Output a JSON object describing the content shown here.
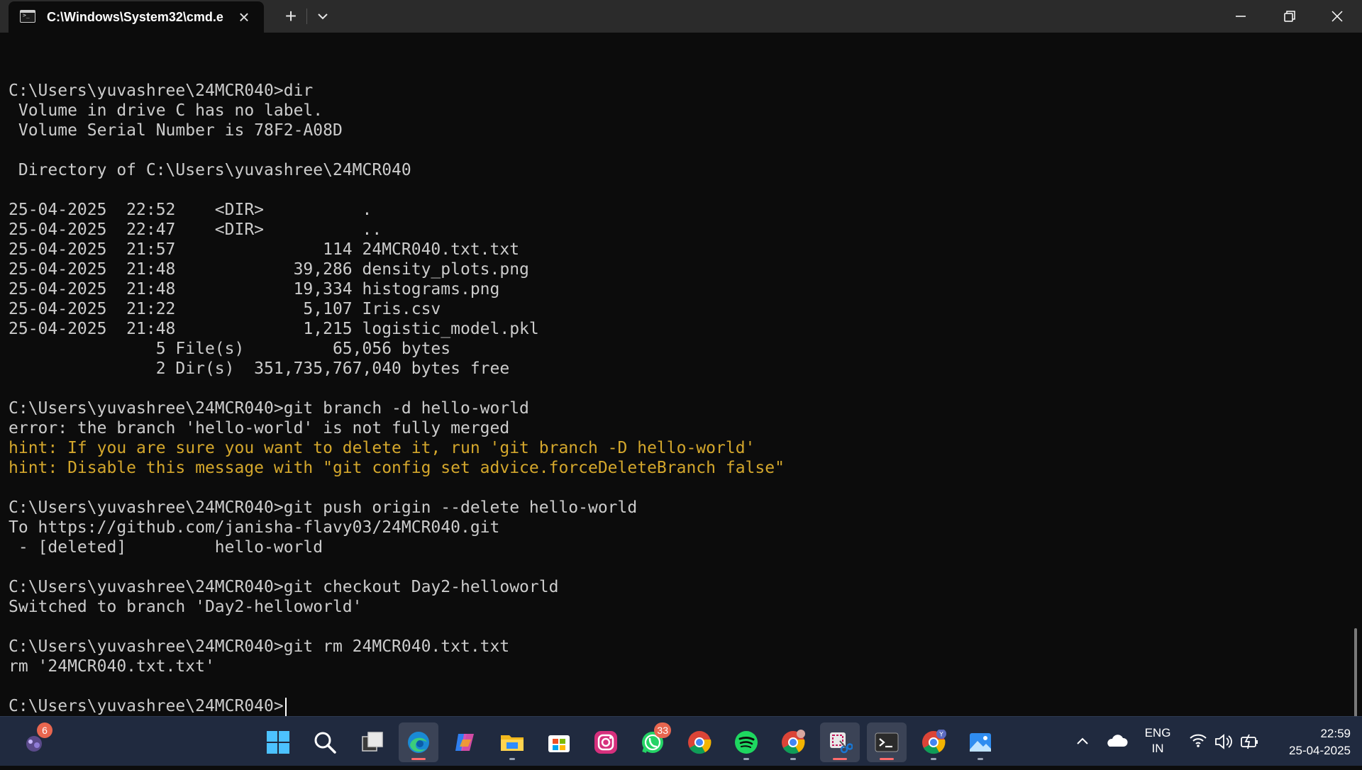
{
  "window": {
    "tab_title": "C:\\Windows\\System32\\cmd.e"
  },
  "terminal": {
    "lines": [
      {
        "text": "",
        "type": "normal"
      },
      {
        "text": "C:\\Users\\yuvashree\\24MCR040>dir",
        "type": "normal"
      },
      {
        "text": " Volume in drive C has no label.",
        "type": "normal"
      },
      {
        "text": " Volume Serial Number is 78F2-A08D",
        "type": "normal"
      },
      {
        "text": "",
        "type": "normal"
      },
      {
        "text": " Directory of C:\\Users\\yuvashree\\24MCR040",
        "type": "normal"
      },
      {
        "text": "",
        "type": "normal"
      },
      {
        "text": "25-04-2025  22:52    <DIR>          .",
        "type": "normal"
      },
      {
        "text": "25-04-2025  22:47    <DIR>          ..",
        "type": "normal"
      },
      {
        "text": "25-04-2025  21:57               114 24MCR040.txt.txt",
        "type": "normal"
      },
      {
        "text": "25-04-2025  21:48            39,286 density_plots.png",
        "type": "normal"
      },
      {
        "text": "25-04-2025  21:48            19,334 histograms.png",
        "type": "normal"
      },
      {
        "text": "25-04-2025  21:22             5,107 Iris.csv",
        "type": "normal"
      },
      {
        "text": "25-04-2025  21:48             1,215 logistic_model.pkl",
        "type": "normal"
      },
      {
        "text": "               5 File(s)         65,056 bytes",
        "type": "normal"
      },
      {
        "text": "               2 Dir(s)  351,735,767,040 bytes free",
        "type": "normal"
      },
      {
        "text": "",
        "type": "normal"
      },
      {
        "text": "C:\\Users\\yuvashree\\24MCR040>git branch -d hello-world",
        "type": "normal"
      },
      {
        "text": "error: the branch 'hello-world' is not fully merged",
        "type": "normal"
      },
      {
        "text": "hint: If you are sure you want to delete it, run 'git branch -D hello-world'",
        "type": "hint"
      },
      {
        "text": "hint: Disable this message with \"git config set advice.forceDeleteBranch false\"",
        "type": "hint"
      },
      {
        "text": "",
        "type": "normal"
      },
      {
        "text": "C:\\Users\\yuvashree\\24MCR040>git push origin --delete hello-world",
        "type": "normal"
      },
      {
        "text": "To https://github.com/janisha-flavy03/24MCR040.git",
        "type": "normal"
      },
      {
        "text": " - [deleted]         hello-world",
        "type": "normal"
      },
      {
        "text": "",
        "type": "normal"
      },
      {
        "text": "C:\\Users\\yuvashree\\24MCR040>git checkout Day2-helloworld",
        "type": "normal"
      },
      {
        "text": "Switched to branch 'Day2-helloworld'",
        "type": "normal"
      },
      {
        "text": "",
        "type": "normal"
      },
      {
        "text": "C:\\Users\\yuvashree\\24MCR040>git rm 24MCR040.txt.txt",
        "type": "normal"
      },
      {
        "text": "rm '24MCR040.txt.txt'",
        "type": "normal"
      },
      {
        "text": "",
        "type": "normal"
      }
    ],
    "prompt": "C:\\Users\\yuvashree\\24MCR040>",
    "hint_color": "#d4a72c",
    "text_color": "#cccccc",
    "background": "#0c0c0c"
  },
  "taskbar": {
    "widgets_badge": "6",
    "whatsapp_badge": "33",
    "chrome_profile_letter": "Y",
    "language": {
      "line1": "ENG",
      "line2": "IN"
    },
    "clock": {
      "time": "22:59",
      "date": "25-04-2025"
    }
  }
}
